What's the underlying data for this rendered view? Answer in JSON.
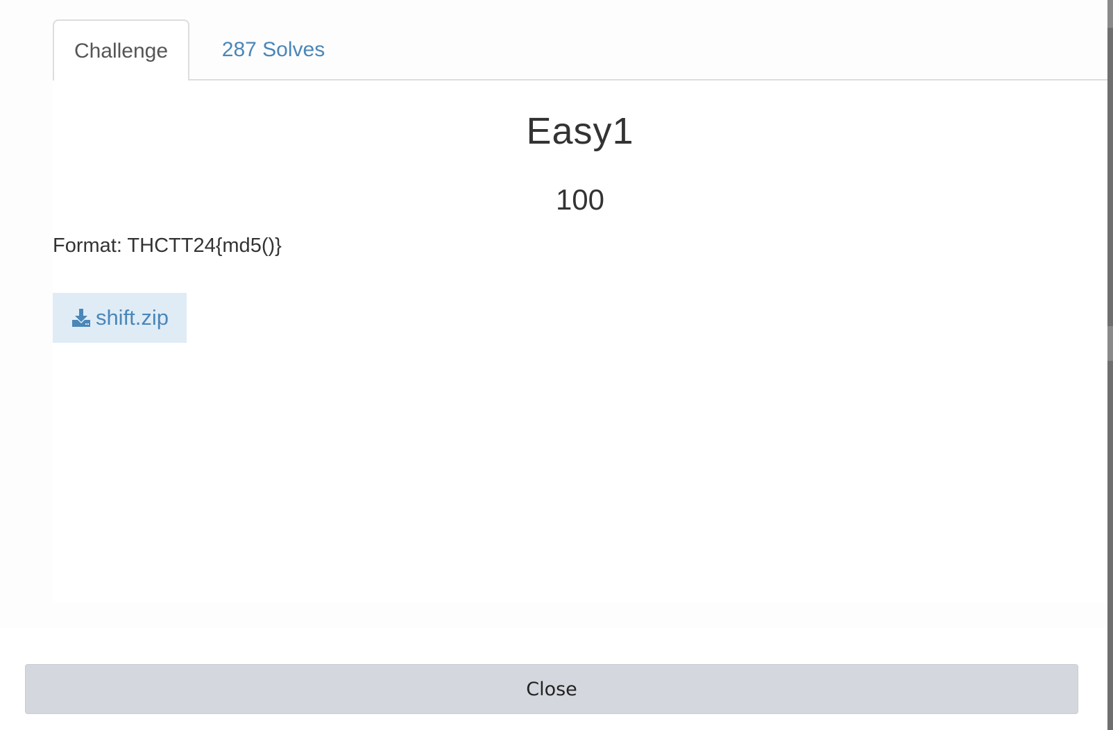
{
  "tabs": [
    {
      "label": "Challenge",
      "active": true
    },
    {
      "label": "287 Solves",
      "active": false
    }
  ],
  "challenge": {
    "name": "Easy1",
    "points": "100",
    "description": "Format: THCTT24{md5()}",
    "file": {
      "icon": "download-icon",
      "label": "shift.zip"
    }
  },
  "footer": {
    "close_label": "Close"
  },
  "colors": {
    "link": "#4a86b8",
    "file_button_bg": "#dfecf6",
    "close_button_bg": "#d4d7de",
    "text": "#333333"
  }
}
